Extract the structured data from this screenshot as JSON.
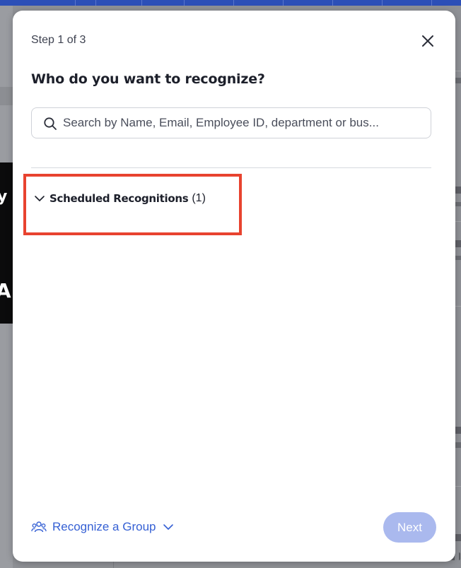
{
  "modal": {
    "step_text": "Step 1 of 3",
    "title": "Who do you want to recognize?",
    "search": {
      "placeholder": "Search by Name, Email, Employee ID, department or bus...",
      "value": ""
    },
    "section": {
      "label": "Scheduled Recognitions",
      "count": "(1)",
      "expanded": true
    },
    "footer": {
      "group_label": "Recognize a Group",
      "next_label": "Next",
      "next_enabled": false
    }
  },
  "colors": {
    "accent": "#3560d4",
    "next_disabled": "#aab9ee",
    "highlight_box": "#e8432f",
    "top_bar": "#2c4fb7"
  },
  "icons": {
    "close": "close-icon",
    "search": "search-icon",
    "section_toggle": "chevron-down-icon",
    "group": "group-icon",
    "group_menu": "chevron-down-icon"
  }
}
